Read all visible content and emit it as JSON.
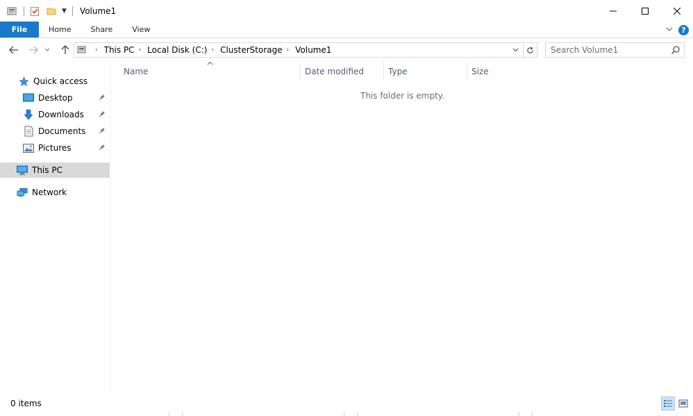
{
  "window": {
    "title": "Volume1"
  },
  "ribbon": {
    "tabs": [
      {
        "label": "File"
      },
      {
        "label": "Home"
      },
      {
        "label": "Share"
      },
      {
        "label": "View"
      }
    ]
  },
  "address": {
    "crumbs": [
      {
        "label": "This PC"
      },
      {
        "label": "Local Disk (C:)"
      },
      {
        "label": "ClusterStorage"
      },
      {
        "label": "Volume1"
      }
    ]
  },
  "search": {
    "placeholder": "Search Volume1"
  },
  "sidebar": {
    "quick_access": "Quick access",
    "items": [
      {
        "label": "Desktop",
        "icon": "desktop-icon"
      },
      {
        "label": "Downloads",
        "icon": "downloads-icon"
      },
      {
        "label": "Documents",
        "icon": "documents-icon"
      },
      {
        "label": "Pictures",
        "icon": "pictures-icon"
      }
    ],
    "this_pc": "This PC",
    "network": "Network"
  },
  "columns": [
    {
      "label": "Name"
    },
    {
      "label": "Date modified"
    },
    {
      "label": "Type"
    },
    {
      "label": "Size"
    }
  ],
  "content": {
    "empty_message": "This folder is empty."
  },
  "status": {
    "item_count": "0 items"
  },
  "colors": {
    "accent": "#1979ca",
    "selected_nav": "#d9d9d9",
    "column_header_text": "#4c607a"
  }
}
